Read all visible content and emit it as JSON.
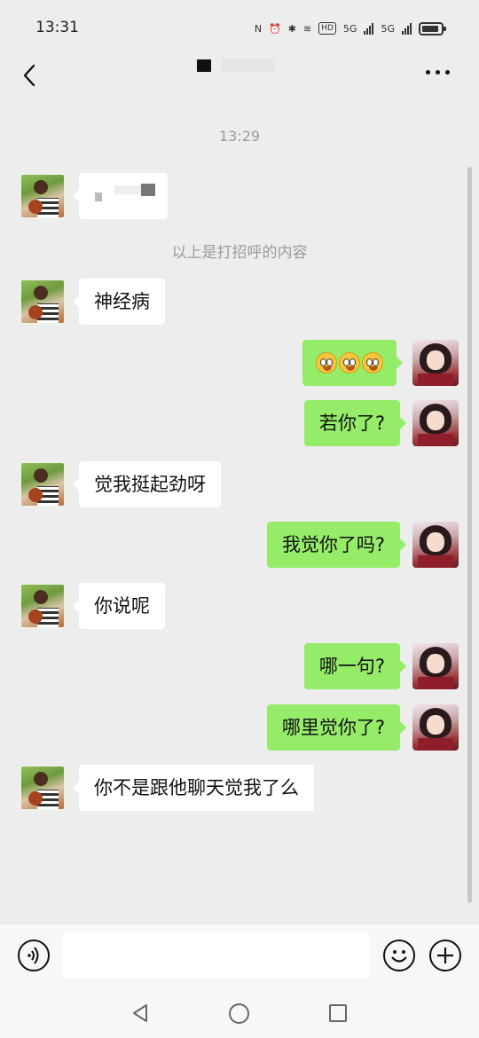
{
  "status_bar": {
    "time": "13:31",
    "net_badge": "HD",
    "sig1": "5G",
    "sig2": "5G"
  },
  "header": {
    "title": "",
    "back_icon": "chevron-left-icon",
    "more_icon": "more-dots-icon"
  },
  "chat": {
    "timestamp": "13:29",
    "greeting_note": "以上是打招呼的内容",
    "messages": [
      {
        "side": "in",
        "text": ""
      },
      {
        "side": "in",
        "text": "神经病"
      },
      {
        "side": "out",
        "text": "",
        "emoji": [
          "tearful-face-emoji",
          "tearful-face-emoji",
          "tearful-face-emoji"
        ]
      },
      {
        "side": "out",
        "text": "若你了?"
      },
      {
        "side": "in",
        "text": "觉我挺起劲呀"
      },
      {
        "side": "out",
        "text": "我觉你了吗?"
      },
      {
        "side": "in",
        "text": "你说呢"
      },
      {
        "side": "out",
        "text": "哪一句?"
      },
      {
        "side": "out",
        "text": "哪里觉你了?"
      },
      {
        "side": "in",
        "text": "你不是跟他聊天觉我了么"
      }
    ]
  },
  "input_bar": {
    "placeholder": "",
    "voice_icon": "voice-icon",
    "emoji_icon": "emoji-icon",
    "plus_icon": "plus-icon"
  },
  "colors": {
    "background": "#ededed",
    "outgoing_bubble": "#95ec69",
    "incoming_bubble": "#ffffff",
    "meta_text": "#9a9a9a"
  }
}
